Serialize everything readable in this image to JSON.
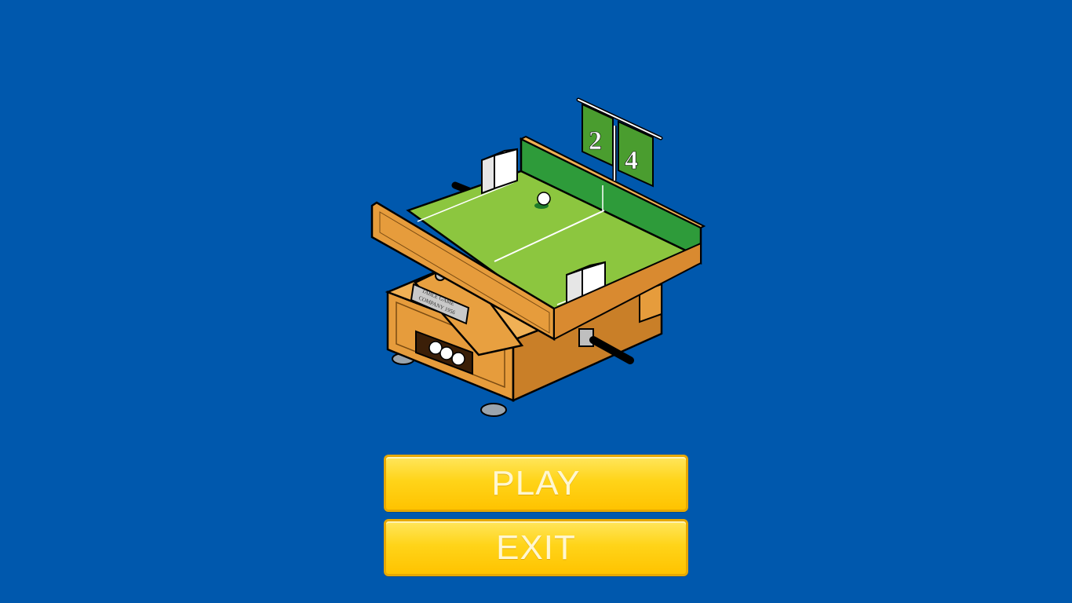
{
  "menu": {
    "play_label": "PLAY",
    "exit_label": "EXIT"
  },
  "scoreboard": {
    "left_score": "2",
    "right_score": "4"
  },
  "plaque": {
    "line1": "TABLE GAME",
    "line2": "COMPANY 1956"
  },
  "colors": {
    "background": "#0058ad",
    "button_fill": "#ffd419",
    "button_border": "#e7a800",
    "table_surface": "#8cc63f",
    "wood": "#e09a3e",
    "flag_green": "#4a9d2f"
  },
  "icons": {
    "illustration": "table-game-icon"
  }
}
